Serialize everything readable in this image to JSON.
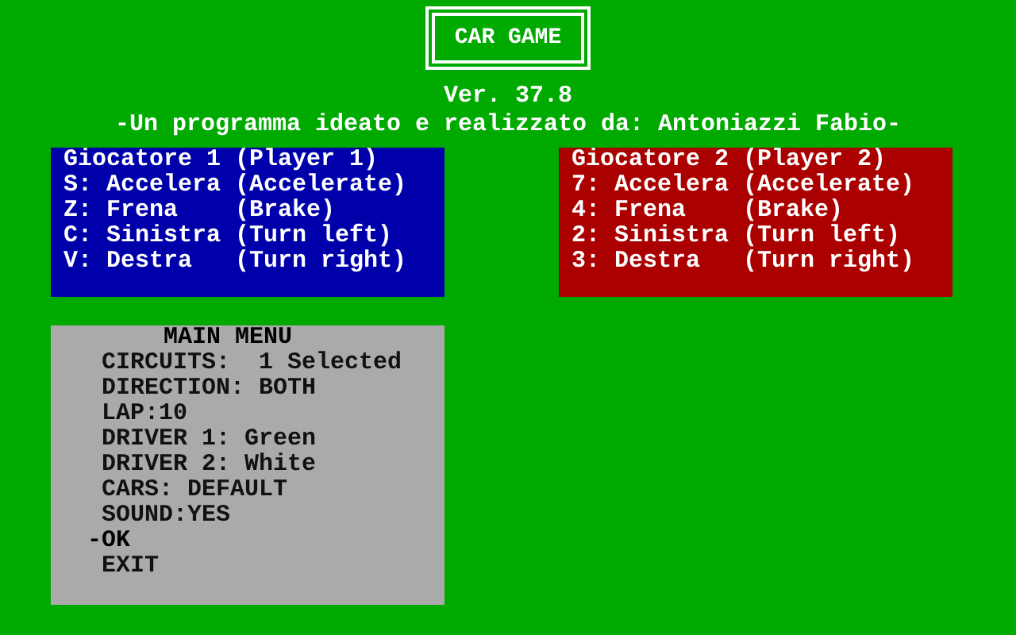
{
  "title": "CAR GAME",
  "version": "Ver. 37.8",
  "credits": "-Un programma ideato e realizzato da: Antoniazzi Fabio-",
  "players": [
    {
      "heading": "Giocatore 1 (Player 1)",
      "color": "#0000aa",
      "keys": [
        "S: Accelera (Accelerate)",
        "Z: Frena    (Brake)",
        "C: Sinistra (Turn left)",
        "V: Destra   (Turn right)"
      ]
    },
    {
      "heading": "Giocatore 2 (Player 2)",
      "color": "#aa0000",
      "keys": [
        "7: Accelera (Accelerate)",
        "4: Frena    (Brake)",
        "2: Sinistra (Turn left)",
        "3: Destra   (Turn right)"
      ]
    }
  ],
  "menu": {
    "title": "MAIN MENU",
    "cursor": "-",
    "items": [
      {
        "label": "CIRCUITS:  1 Selected",
        "selected": false
      },
      {
        "label": "DIRECTION: BOTH",
        "selected": false
      },
      {
        "label": "LAP:10",
        "selected": false
      },
      {
        "label": "DRIVER 1: Green",
        "selected": false
      },
      {
        "label": "DRIVER 2: White",
        "selected": false
      },
      {
        "label": "CARS: DEFAULT",
        "selected": false
      },
      {
        "label": "SOUND:YES",
        "selected": false
      },
      {
        "label": "OK",
        "selected": true
      },
      {
        "label": "EXIT",
        "selected": false
      }
    ]
  }
}
